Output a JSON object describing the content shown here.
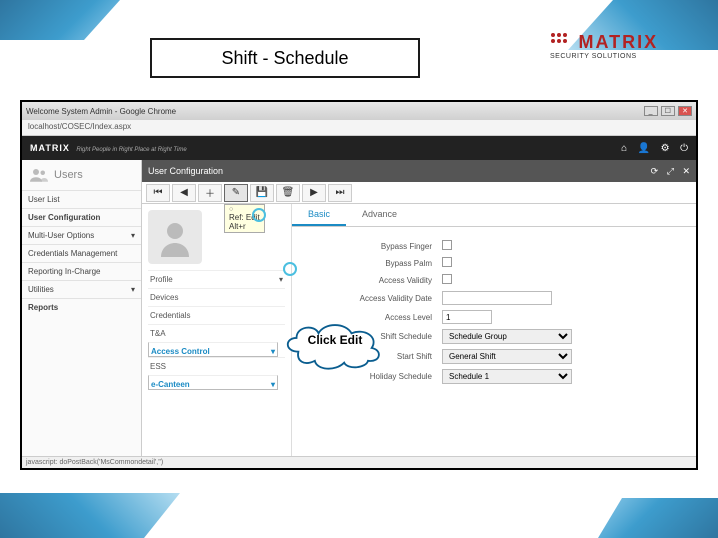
{
  "slide": {
    "title": "Shift - Schedule"
  },
  "logo": {
    "brand": "MATRIX",
    "tagline": "SECURITY SOLUTIONS"
  },
  "browser": {
    "title": "Welcome System Admin - Google Chrome",
    "url": "localhost/COSEC/Index.aspx"
  },
  "app_header": {
    "brand": "MATRIX",
    "tagline": "Right People in Right Place at Right Time"
  },
  "sidebar": {
    "header": "Users",
    "items": [
      "User List",
      "User Configuration",
      "Multi-User Options",
      "Credentials Management",
      "Reporting In-Charge",
      "Utilities",
      "Reports"
    ]
  },
  "panel": {
    "title": "User Configuration",
    "toolbar_tooltip": {
      "line1": "Edit",
      "line2": "Ref: Edit",
      "line3": "Alt+r"
    },
    "left_sections": [
      "Profile",
      "Devices",
      "Credentials",
      "T&A",
      "Access Control",
      "ESS",
      "e-Canteen"
    ],
    "tabs": {
      "basic": "Basic",
      "advance": "Advance"
    },
    "fields": {
      "bypass_finger": {
        "label": "Bypass Finger"
      },
      "bypass_palm": {
        "label": "Bypass Palm"
      },
      "access_validity": {
        "label": "Access Validity"
      },
      "access_validity_date": {
        "label": "Access Validity Date"
      },
      "access_level": {
        "label": "Access Level",
        "value": "1"
      },
      "shift_schedule": {
        "label": "Shift Schedule",
        "value": "Schedule Group"
      },
      "start_shift": {
        "label": "Start Shift",
        "value": "General Shift"
      },
      "holiday_schedule": {
        "label": "Holiday Schedule",
        "value": "Schedule 1"
      }
    }
  },
  "callout": {
    "text": "Click Edit"
  },
  "status_bar": "javascript:  doPostBack('MsCommondetail','')"
}
